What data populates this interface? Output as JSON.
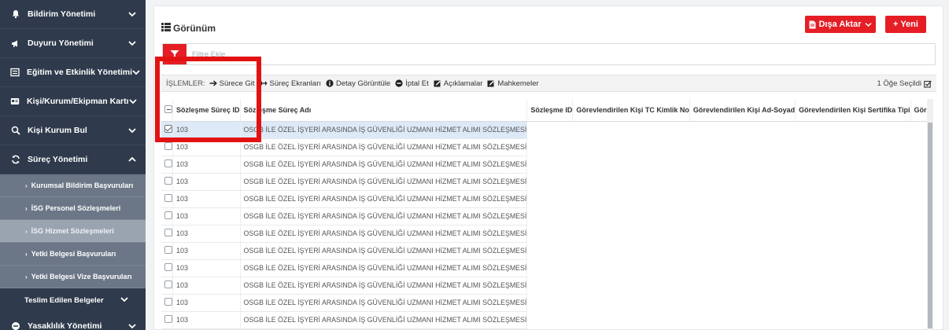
{
  "sidebar": {
    "items": [
      {
        "label": "Bildirim Yönetimi",
        "icon": "bell-icon"
      },
      {
        "label": "Duyuru Yönetimi",
        "icon": "megaphone-icon"
      },
      {
        "label": "Eğitim ve Etkinlik Yönetimi",
        "icon": "list-icon"
      },
      {
        "label": "Kişi/Kurum/Ekipman Kartı",
        "icon": "id-card-icon"
      },
      {
        "label": "Kişi Kurum Bul",
        "icon": "search-icon"
      },
      {
        "label": "Süreç Yönetimi",
        "icon": "refresh-icon"
      }
    ],
    "sub_items": [
      {
        "label": "Kurumsal Bildirim Başvuruları"
      },
      {
        "label": "İSG Personel Sözleşmeleri"
      },
      {
        "label": "İSG Hizmet Sözleşmeleri"
      },
      {
        "label": "Yetki Belgesi Başvuruları"
      },
      {
        "label": "Yetki Belgesi Vize Başvuruları"
      }
    ],
    "teslim": "Teslim Edilen Belgeler",
    "last_item": {
      "label": "Yasaklılık Yönetimi",
      "icon": "minus-circle-icon"
    }
  },
  "header": {
    "title": "Görünüm",
    "export_label": "Dışa Aktar",
    "new_label": "+ Yeni"
  },
  "filter": {
    "placeholder": "Filtre Ekle"
  },
  "toolbar": {
    "label": "İŞLEMLER:",
    "actions": [
      {
        "label": "Sürece Git",
        "icon": "arrow-right-icon"
      },
      {
        "label": "Süreç Ekranları",
        "icon": "arrows-lr-icon"
      },
      {
        "label": "Detay Görüntüle",
        "icon": "info-icon"
      },
      {
        "label": "İptal Et",
        "icon": "minus-circle-icon"
      },
      {
        "label": "Açıklamalar",
        "icon": "edit-icon"
      },
      {
        "label": "Mahkemeler",
        "icon": "edit-icon"
      }
    ],
    "selected_count": "1 Öğe Seçildi"
  },
  "table": {
    "columns": [
      "Sözleşme Süreç ID",
      "Sözleşme Süreç Adı",
      "Sözleşme ID",
      "Görevlendirilen Kişi TC Kimlik No",
      "Görevlendirilen Kişi Ad-Soyad",
      "Görevlendirilen Kişi Sertifika Tipi",
      "Görevlen"
    ],
    "rows": [
      {
        "id": "103",
        "name": "OSGB İLE ÖZEL İŞYERİ ARASINDA İŞ GÜVENLİĞİ UZMANI HİZMET ALIMI SÖZLEŞMESİ"
      },
      {
        "id": "103",
        "name": "OSGB İLE ÖZEL İŞYERİ ARASINDA İŞ GÜVENLİĞİ UZMANI HİZMET ALIMI SÖZLEŞMESİ"
      },
      {
        "id": "103",
        "name": "OSGB İLE ÖZEL İŞYERİ ARASINDA İŞ GÜVENLİĞİ UZMANI HİZMET ALIMI SÖZLEŞMESİ"
      },
      {
        "id": "103",
        "name": "OSGB İLE ÖZEL İŞYERİ ARASINDA İŞ GÜVENLİĞİ UZMANI HİZMET ALIMI SÖZLEŞMESİ"
      },
      {
        "id": "103",
        "name": "OSGB İLE ÖZEL İŞYERİ ARASINDA İŞ GÜVENLİĞİ UZMANI HİZMET ALIMI SÖZLEŞMESİ"
      },
      {
        "id": "103",
        "name": "OSGB İLE ÖZEL İŞYERİ ARASINDA İŞ GÜVENLİĞİ UZMANI HİZMET ALIMI SÖZLEŞMESİ"
      },
      {
        "id": "103",
        "name": "OSGB İLE ÖZEL İŞYERİ ARASINDA İŞ GÜVENLİĞİ UZMANI HİZMET ALIMI SÖZLEŞMESİ"
      },
      {
        "id": "103",
        "name": "OSGB İLE ÖZEL İŞYERİ ARASINDA İŞ GÜVENLİĞİ UZMANI HİZMET ALIMI SÖZLEŞMESİ"
      },
      {
        "id": "103",
        "name": "OSGB İLE ÖZEL İŞYERİ ARASINDA İŞ GÜVENLİĞİ UZMANI HİZMET ALIMI SÖZLEŞMESİ"
      },
      {
        "id": "103",
        "name": "OSGB İLE ÖZEL İŞYERİ ARASINDA İŞ GÜVENLİĞİ UZMANI HİZMET ALIMI SÖZLEŞMESİ"
      },
      {
        "id": "103",
        "name": "OSGB İLE ÖZEL İŞYERİ ARASINDA İŞ GÜVENLİĞİ UZMANI HİZMET ALIMI SÖZLEŞMESİ"
      },
      {
        "id": "103",
        "name": "OSGB İLE ÖZEL İŞYERİ ARASINDA İŞ GÜVENLİĞİ UZMANI HİZMET ALIMI SÖZLEŞMESİ"
      }
    ],
    "selected_row": 0
  },
  "colors": {
    "sidebar_bg": "#2f3b4c",
    "sidebar_sub_bg": "#6b7786",
    "accent_red": "#e51e25",
    "selected_row": "#dde9f7"
  }
}
